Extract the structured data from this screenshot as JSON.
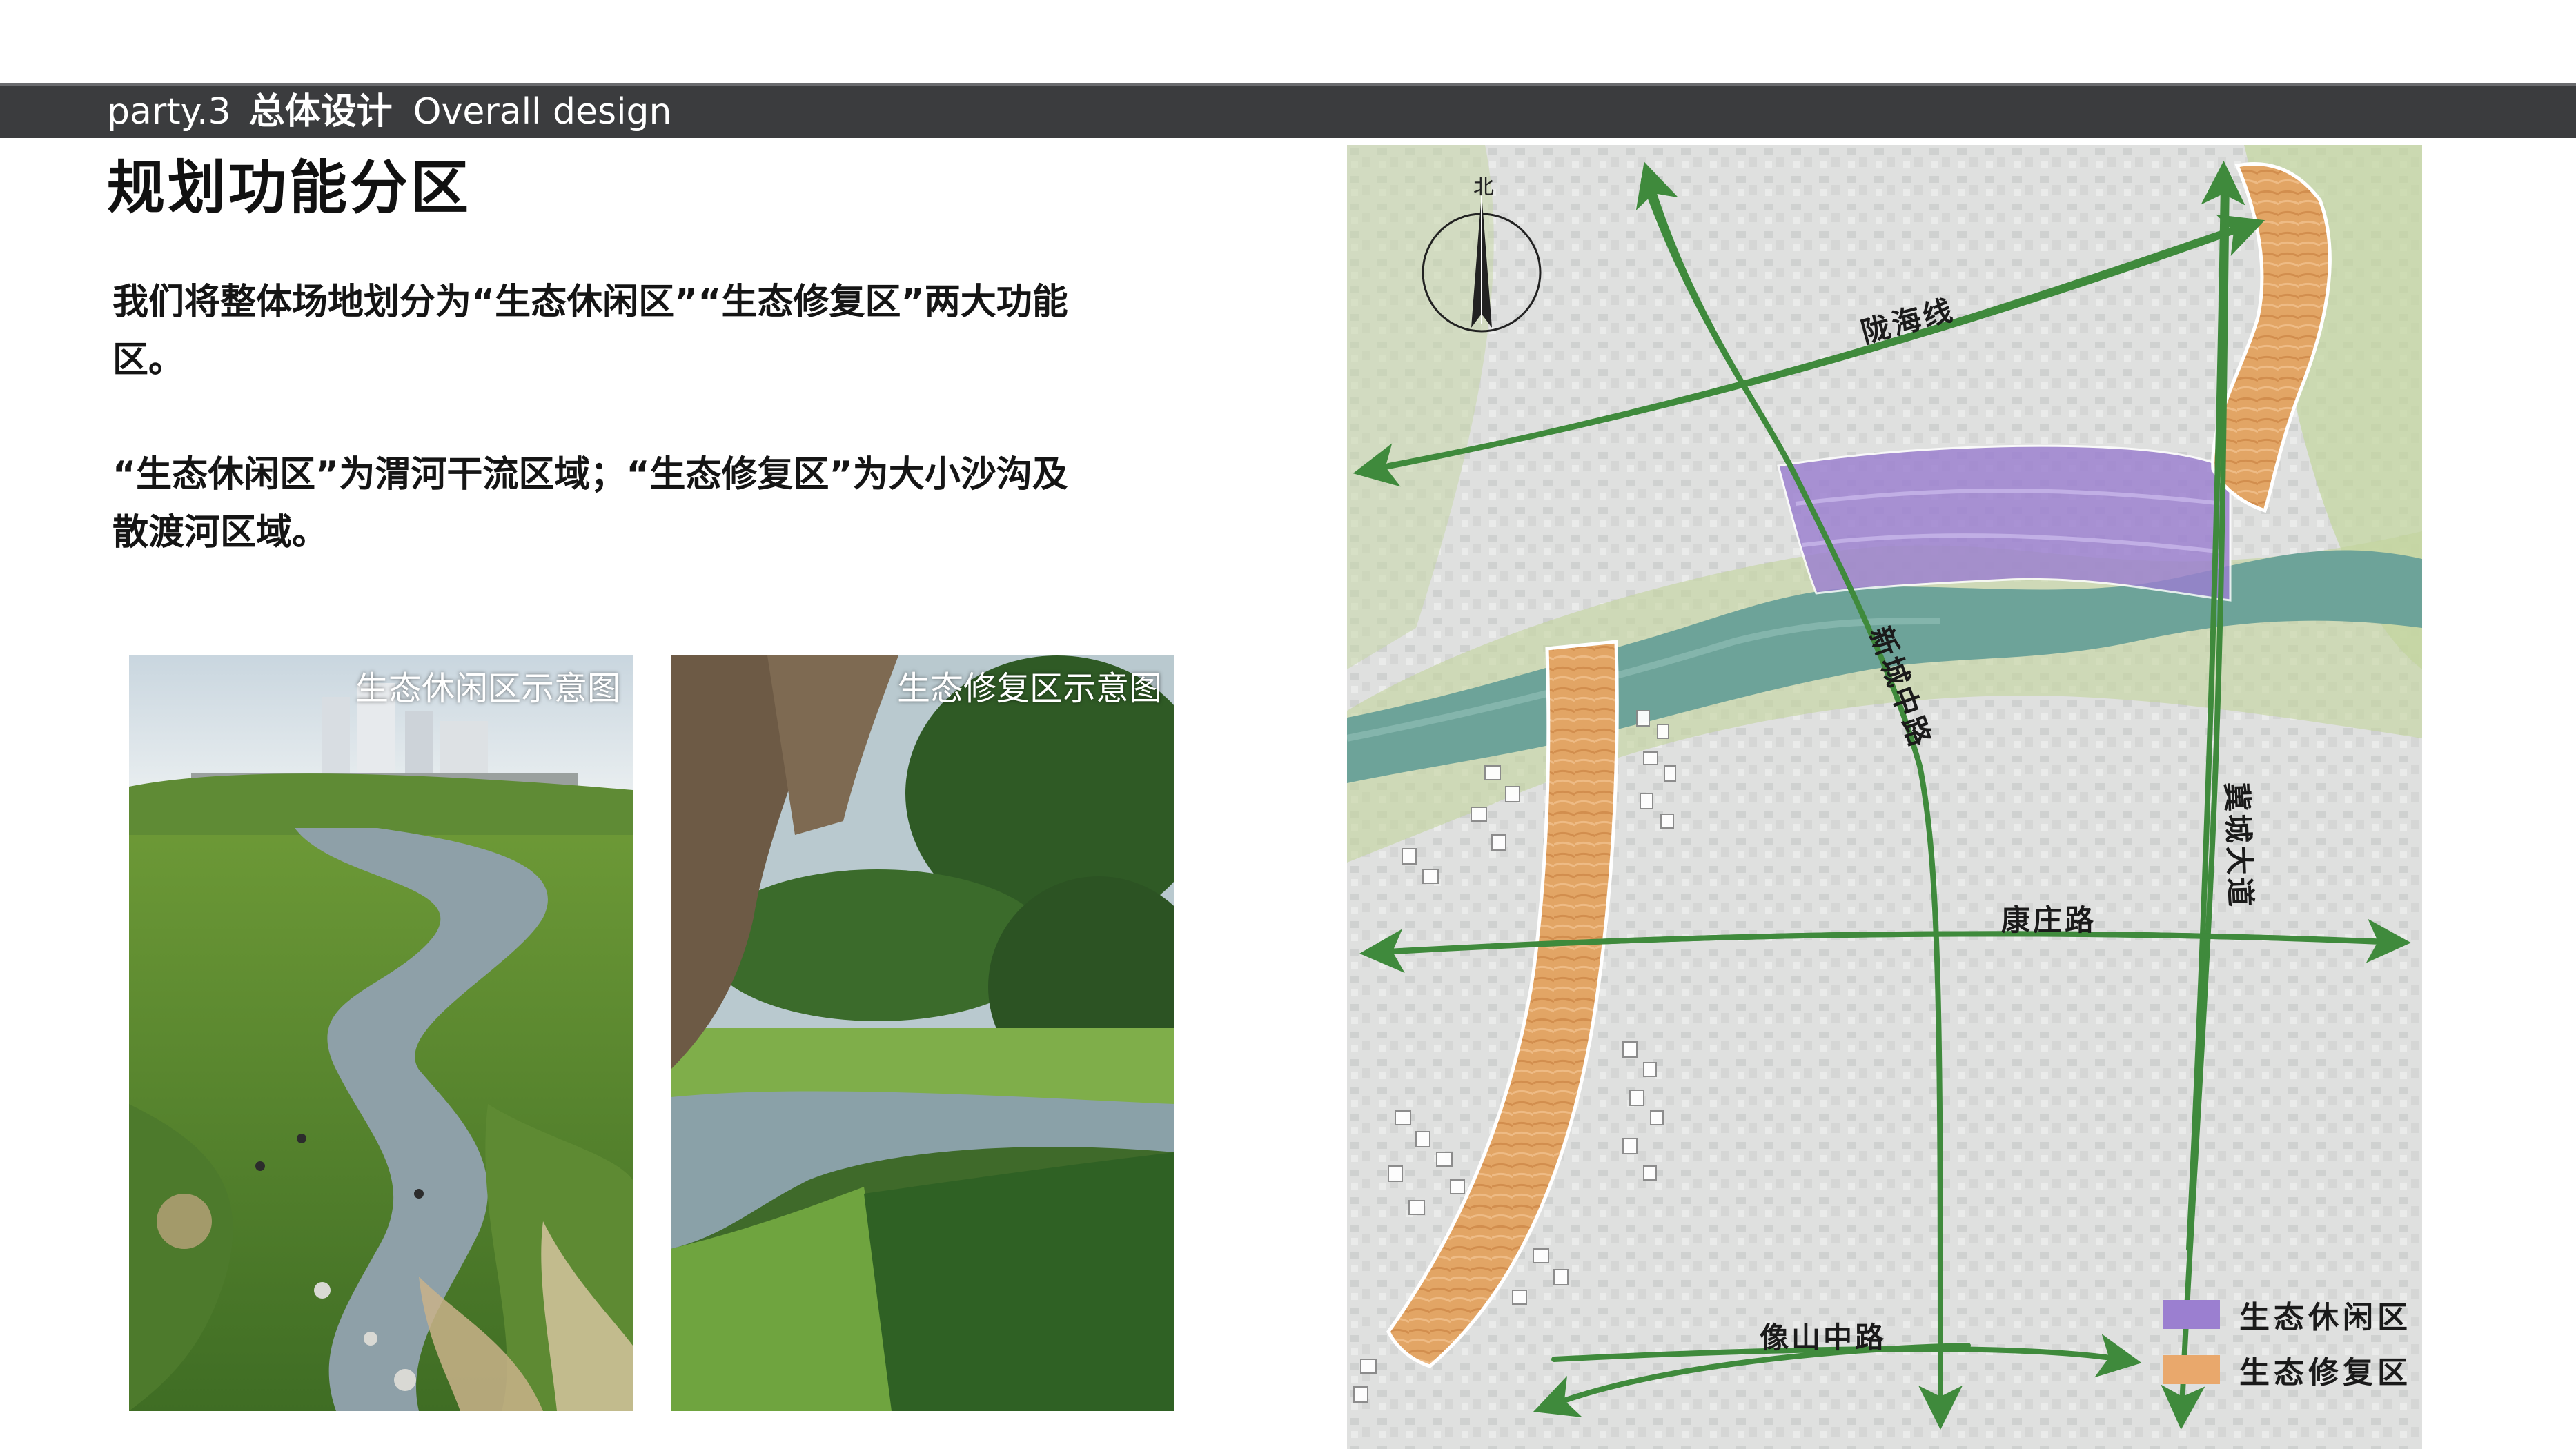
{
  "header": {
    "section_number": "party.3",
    "section_title_cn": "总体设计",
    "section_title_en": "Overall design"
  },
  "page_title": "规划功能分区",
  "intro": {
    "para1": "我们将整体场地划分为“生态休闲区”“生态修复区”两大功能区。",
    "para2": "“生态休闲区”为渭河干流区域；“生态修复区”为大小沙沟及散渡河区域。"
  },
  "photos": [
    {
      "caption": "生态休闲区示意图"
    },
    {
      "caption": "生态修复区示意图"
    }
  ],
  "map": {
    "compass_label": "北",
    "roads": {
      "longhai": "陇海线",
      "xincheng": "新城中路",
      "jicheng": "冀城大道",
      "kangzhuang": "康庄路",
      "xiangshan": "像山中路"
    },
    "legend": [
      {
        "label": "生态休闲区",
        "color": "#9b7fd0"
      },
      {
        "label": "生态修复区",
        "color": "#e9a86c"
      }
    ],
    "colors": {
      "road_arrow": "#3f8a3c",
      "restoration_outline": "#ffffff"
    }
  }
}
